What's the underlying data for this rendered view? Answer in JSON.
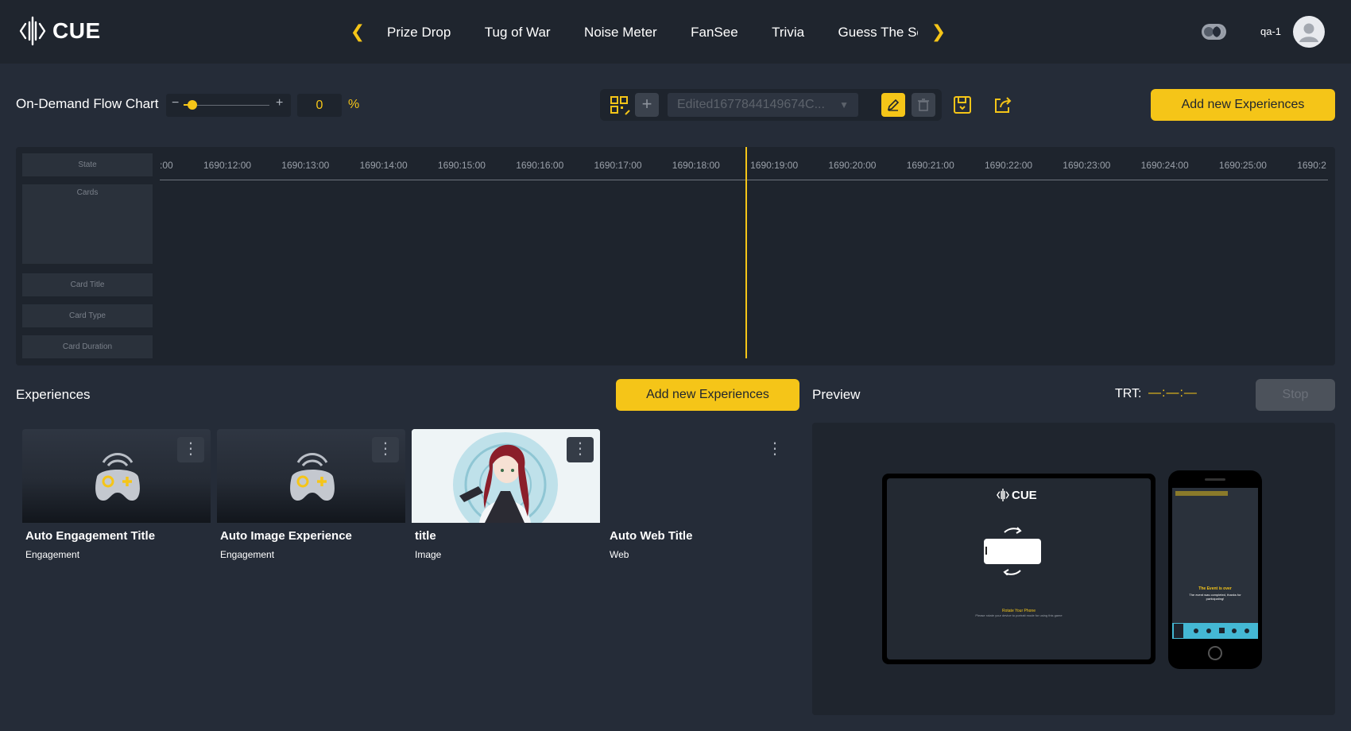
{
  "app": {
    "brand": "CUE",
    "user": "qa-1"
  },
  "nav": {
    "tabs": [
      "Prize Drop",
      "Tug of War",
      "Noise Meter",
      "FanSee",
      "Trivia",
      "Guess The Score"
    ]
  },
  "toolbar": {
    "title": "On-Demand Flow Chart",
    "zoom_value": "0",
    "zoom_level": 0.1,
    "percent_sign": "%",
    "flow_name": "Edited1677844149674C...",
    "add_button": "Add new Experiences"
  },
  "timeline": {
    "row_labels": [
      "State",
      "Cards",
      "Card Title",
      "Card Type",
      "Card Duration"
    ],
    "ticks": [
      ":00",
      "1690:12:00",
      "1690:13:00",
      "1690:14:00",
      "1690:15:00",
      "1690:16:00",
      "1690:17:00",
      "1690:18:00",
      "1690:19:00",
      "1690:20:00",
      "1690:21:00",
      "1690:22:00",
      "1690:23:00",
      "1690:24:00",
      "1690:25:00",
      "1690:2"
    ]
  },
  "experiences": {
    "title": "Experiences",
    "add_button": "Add new Experiences",
    "cards": [
      {
        "title": "Auto Engagement Title",
        "type": "Engagement",
        "icon": "gamepad-plus-icon"
      },
      {
        "title": "Auto Image Experience",
        "type": "Engagement",
        "icon": "gamepad-plus-icon"
      },
      {
        "title": "title",
        "type": "Image",
        "icon": "anime-character-image"
      },
      {
        "title": "Auto Web Title",
        "type": "Web",
        "icon": "none"
      }
    ]
  },
  "preview": {
    "title": "Preview",
    "trt_label": "TRT:",
    "trt_value": "—:—:—",
    "stop_button": "Stop",
    "tablet_brand": "CUE",
    "tablet_heading": "Rotate Your Phone",
    "tablet_text": "Please rotate your device to portrait mode for using this game",
    "phone_heading": "The Event is over",
    "phone_text": "The event was completed, thanks for participating!"
  },
  "colors": {
    "accent": "#f5c518",
    "background": "#252c38",
    "panel": "#1e242d"
  }
}
